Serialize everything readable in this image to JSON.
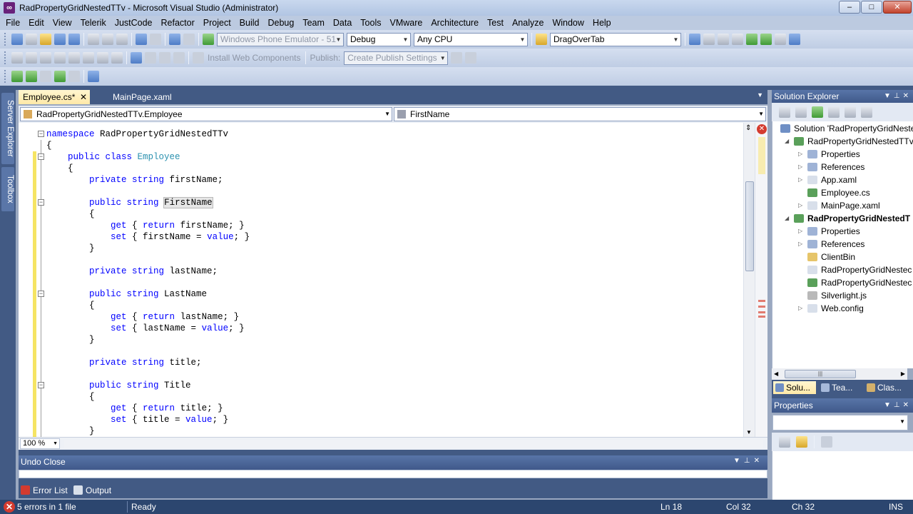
{
  "window": {
    "title": "RadPropertyGridNestedTTv - Microsoft Visual Studio (Administrator)",
    "min_label": "–",
    "max_label": "□",
    "close_label": "✕"
  },
  "menu": [
    "File",
    "Edit",
    "View",
    "Telerik",
    "JustCode",
    "Refactor",
    "Project",
    "Build",
    "Debug",
    "Team",
    "Data",
    "Tools",
    "VMware",
    "Architecture",
    "Test",
    "Analyze",
    "Window",
    "Help"
  ],
  "toolbar1": {
    "target_device": "Windows Phone Emulator - 51",
    "config": "Debug",
    "platform": "Any CPU",
    "find": "DragOverTab"
  },
  "toolbar2": {
    "install_label": "Install Web Components",
    "publish_label": "Publish:",
    "publish_value": "Create Publish Settings"
  },
  "side_tabs": [
    "Server Explorer",
    "Toolbox"
  ],
  "doc_tabs": [
    {
      "label": "Employee.cs*"
    },
    {
      "label": "MainPage.xaml"
    }
  ],
  "close_glyph": "✕",
  "nav": {
    "type_combo": "RadPropertyGridNestedTTv.Employee",
    "member_combo": "FirstName"
  },
  "code": [
    {
      "parts": [
        {
          "t": "kw",
          "v": "namespace"
        },
        {
          "t": "",
          "v": " RadPropertyGridNestedTTv"
        }
      ]
    },
    {
      "parts": [
        {
          "t": "",
          "v": "{"
        }
      ]
    },
    {
      "parts": [
        {
          "t": "",
          "v": "    "
        },
        {
          "t": "kw",
          "v": "public class"
        },
        {
          "t": "",
          "v": " "
        },
        {
          "t": "ty",
          "v": "Employee"
        }
      ]
    },
    {
      "parts": [
        {
          "t": "",
          "v": "    {"
        }
      ]
    },
    {
      "parts": [
        {
          "t": "",
          "v": "        "
        },
        {
          "t": "kw",
          "v": "private string"
        },
        {
          "t": "",
          "v": " firstName;"
        }
      ]
    },
    {
      "parts": [
        {
          "t": "",
          "v": ""
        }
      ]
    },
    {
      "parts": [
        {
          "t": "",
          "v": "        "
        },
        {
          "t": "kw",
          "v": "public string"
        },
        {
          "t": "",
          "v": " "
        },
        {
          "t": "hl",
          "v": "FirstName"
        }
      ]
    },
    {
      "parts": [
        {
          "t": "",
          "v": "        {"
        }
      ]
    },
    {
      "parts": [
        {
          "t": "",
          "v": "            "
        },
        {
          "t": "kw",
          "v": "get"
        },
        {
          "t": "",
          "v": " { "
        },
        {
          "t": "kw",
          "v": "return"
        },
        {
          "t": "",
          "v": " firstName; }"
        }
      ]
    },
    {
      "parts": [
        {
          "t": "",
          "v": "            "
        },
        {
          "t": "kw",
          "v": "set"
        },
        {
          "t": "",
          "v": " { firstName = "
        },
        {
          "t": "kw",
          "v": "value"
        },
        {
          "t": "",
          "v": "; }"
        }
      ]
    },
    {
      "parts": [
        {
          "t": "",
          "v": "        }"
        }
      ]
    },
    {
      "parts": [
        {
          "t": "",
          "v": ""
        }
      ]
    },
    {
      "parts": [
        {
          "t": "",
          "v": "        "
        },
        {
          "t": "kw",
          "v": "private string"
        },
        {
          "t": "",
          "v": " lastName;"
        }
      ]
    },
    {
      "parts": [
        {
          "t": "",
          "v": ""
        }
      ]
    },
    {
      "parts": [
        {
          "t": "",
          "v": "        "
        },
        {
          "t": "kw",
          "v": "public string"
        },
        {
          "t": "",
          "v": " LastName"
        }
      ]
    },
    {
      "parts": [
        {
          "t": "",
          "v": "        {"
        }
      ]
    },
    {
      "parts": [
        {
          "t": "",
          "v": "            "
        },
        {
          "t": "kw",
          "v": "get"
        },
        {
          "t": "",
          "v": " { "
        },
        {
          "t": "kw",
          "v": "return"
        },
        {
          "t": "",
          "v": " lastName; }"
        }
      ]
    },
    {
      "parts": [
        {
          "t": "",
          "v": "            "
        },
        {
          "t": "kw",
          "v": "set"
        },
        {
          "t": "",
          "v": " { lastName = "
        },
        {
          "t": "kw",
          "v": "value"
        },
        {
          "t": "",
          "v": "; }"
        }
      ]
    },
    {
      "parts": [
        {
          "t": "",
          "v": "        }"
        }
      ]
    },
    {
      "parts": [
        {
          "t": "",
          "v": ""
        }
      ]
    },
    {
      "parts": [
        {
          "t": "",
          "v": "        "
        },
        {
          "t": "kw",
          "v": "private string"
        },
        {
          "t": "",
          "v": " title;"
        }
      ]
    },
    {
      "parts": [
        {
          "t": "",
          "v": ""
        }
      ]
    },
    {
      "parts": [
        {
          "t": "",
          "v": "        "
        },
        {
          "t": "kw",
          "v": "public string"
        },
        {
          "t": "",
          "v": " Title"
        }
      ]
    },
    {
      "parts": [
        {
          "t": "",
          "v": "        {"
        }
      ]
    },
    {
      "parts": [
        {
          "t": "",
          "v": "            "
        },
        {
          "t": "kw",
          "v": "get"
        },
        {
          "t": "",
          "v": " { "
        },
        {
          "t": "kw",
          "v": "return"
        },
        {
          "t": "",
          "v": " title; }"
        }
      ]
    },
    {
      "parts": [
        {
          "t": "",
          "v": "            "
        },
        {
          "t": "kw",
          "v": "set"
        },
        {
          "t": "",
          "v": " { title = "
        },
        {
          "t": "kw",
          "v": "value"
        },
        {
          "t": "",
          "v": "; }"
        }
      ]
    },
    {
      "parts": [
        {
          "t": "",
          "v": "        }"
        }
      ]
    }
  ],
  "zoom": "100 %",
  "undo_panel": {
    "title": "Undo Close"
  },
  "bottom_tabs": [
    "Error List",
    "Output"
  ],
  "status": {
    "errors": "5 errors in 1 file",
    "ready": "Ready",
    "ln": "Ln 18",
    "col": "Col 32",
    "ch": "Ch 32",
    "ins": "INS"
  },
  "solution_explorer": {
    "title": "Solution Explorer",
    "items": [
      {
        "label": "Solution 'RadPropertyGridNested",
        "bold": false
      },
      {
        "label": "RadPropertyGridNestedTTv",
        "bold": false
      },
      {
        "label": "Properties",
        "bold": false
      },
      {
        "label": "References",
        "bold": false
      },
      {
        "label": "App.xaml",
        "bold": false
      },
      {
        "label": "Employee.cs",
        "bold": false
      },
      {
        "label": "MainPage.xaml",
        "bold": false
      },
      {
        "label": "RadPropertyGridNestedT",
        "bold": true
      },
      {
        "label": "Properties",
        "bold": false
      },
      {
        "label": "References",
        "bold": false
      },
      {
        "label": "ClientBin",
        "bold": false
      },
      {
        "label": "RadPropertyGridNestec",
        "bold": false
      },
      {
        "label": "RadPropertyGridNestec",
        "bold": false
      },
      {
        "label": "Silverlight.js",
        "bold": false
      },
      {
        "label": "Web.config",
        "bold": false
      }
    ],
    "tabs": [
      "Solu...",
      "Tea...",
      "Clas..."
    ]
  },
  "properties": {
    "title": "Properties"
  }
}
